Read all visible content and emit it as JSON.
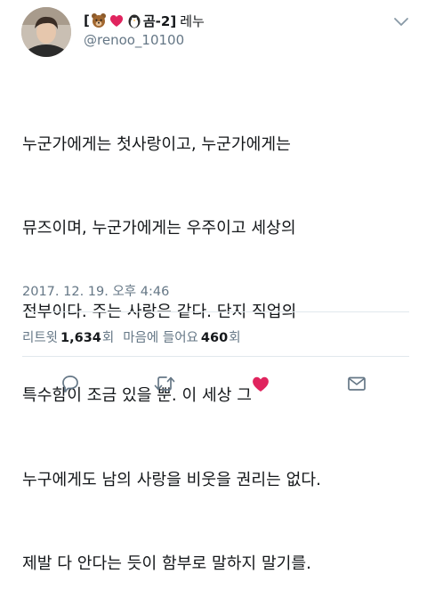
{
  "user": {
    "bracket_open": "[",
    "label": "곰-2]",
    "display_name": "레누",
    "handle": "@renoo_10100",
    "emoji": [
      "bear-emoji",
      "red-heart-emoji",
      "penguin-emoji"
    ]
  },
  "tweet": {
    "lines": [
      "누군가에게는 첫사랑이고, 누군가에게는",
      "뮤즈이며, 누군가에게는 우주이고 세상의",
      "전부이다. 주는 사랑은 같다. 단지 직업의",
      "특수함이 조금 있을 뿐. 이 세상 그",
      "누구에게도 남의 사랑을 비웃을 권리는 없다.",
      "제발 다 안다는 듯이 함부로 말하지 말기를."
    ],
    "timestamp": "2017. 12. 19. 오후 4:46"
  },
  "stats": {
    "retweets_label": "리트윗",
    "retweets_count": "1,634",
    "retweets_unit": "회",
    "likes_label": "마음에 들어요",
    "likes_count": "460",
    "likes_unit": "회"
  },
  "colors": {
    "text": "#14171a",
    "secondary": "#657786",
    "like_active": "#e0245e",
    "divider": "#e1e8ed"
  },
  "icons": [
    "chevron-down-icon",
    "reply-icon",
    "retweet-icon",
    "like-icon",
    "direct-message-icon"
  ]
}
